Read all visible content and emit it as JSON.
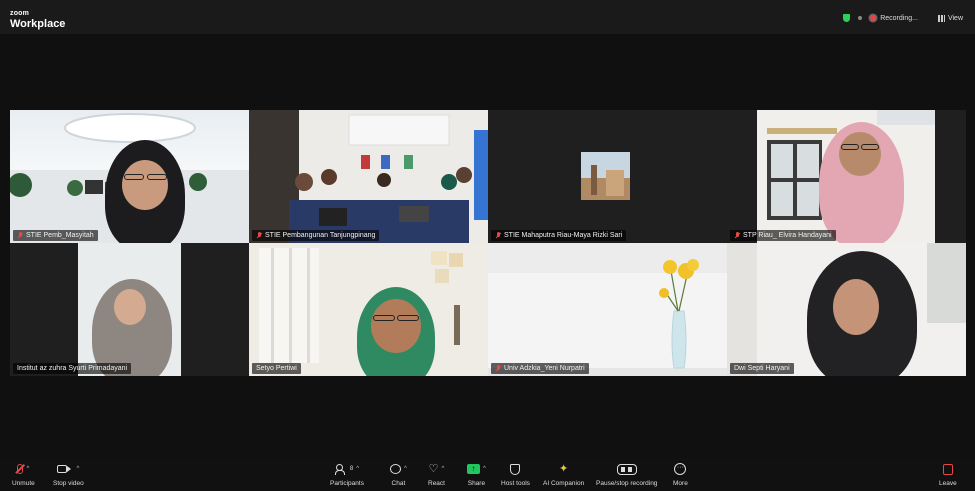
{
  "app": {
    "brand_top": "zoom",
    "brand_bottom": "Workplace"
  },
  "topbar": {
    "recording_label": "Recording...",
    "view_label": "View"
  },
  "participants": [
    {
      "name": "STIE Pemb_Masyitah",
      "muted": true
    },
    {
      "name": "STIE Pembangunan Tanjungpinang",
      "muted": true
    },
    {
      "name": "STIE Mahaputra Riau-Maya Rizki Sari",
      "muted": true
    },
    {
      "name": "STP Riau_ Elvira Handayani",
      "muted": true
    },
    {
      "name": "Institut az zuhra Syurti Primadayani",
      "muted": false
    },
    {
      "name": "Setyo Pertiwi",
      "muted": false,
      "active_speaker": true
    },
    {
      "name": "Univ Adzkia_Yeni Nurpatri",
      "muted": true
    },
    {
      "name": "Dwi Septi Haryani",
      "muted": false
    }
  ],
  "toolbar": {
    "unmute": "Unmute",
    "stop_video": "Stop video",
    "participants": "Participants",
    "participants_count": "8",
    "chat": "Chat",
    "react": "React",
    "share": "Share",
    "host_tools": "Host tools",
    "ai_companion": "AI Companion",
    "pause_recording": "Pause/stop recording",
    "more": "More",
    "leave": "Leave"
  },
  "colors": {
    "active_speaker_border": "#27c04a",
    "share_green": "#22c55e",
    "muted_red": "#e54848",
    "recording_red": "#e04444"
  },
  "icons": [
    "shield-icon",
    "recording-icon",
    "view-grid-icon",
    "mic-muted-icon",
    "camera-icon",
    "participants-icon",
    "chat-icon",
    "react-icon",
    "share-icon",
    "host-tools-icon",
    "ai-companion-icon",
    "pause-record-icon",
    "more-icon",
    "leave-icon"
  ]
}
